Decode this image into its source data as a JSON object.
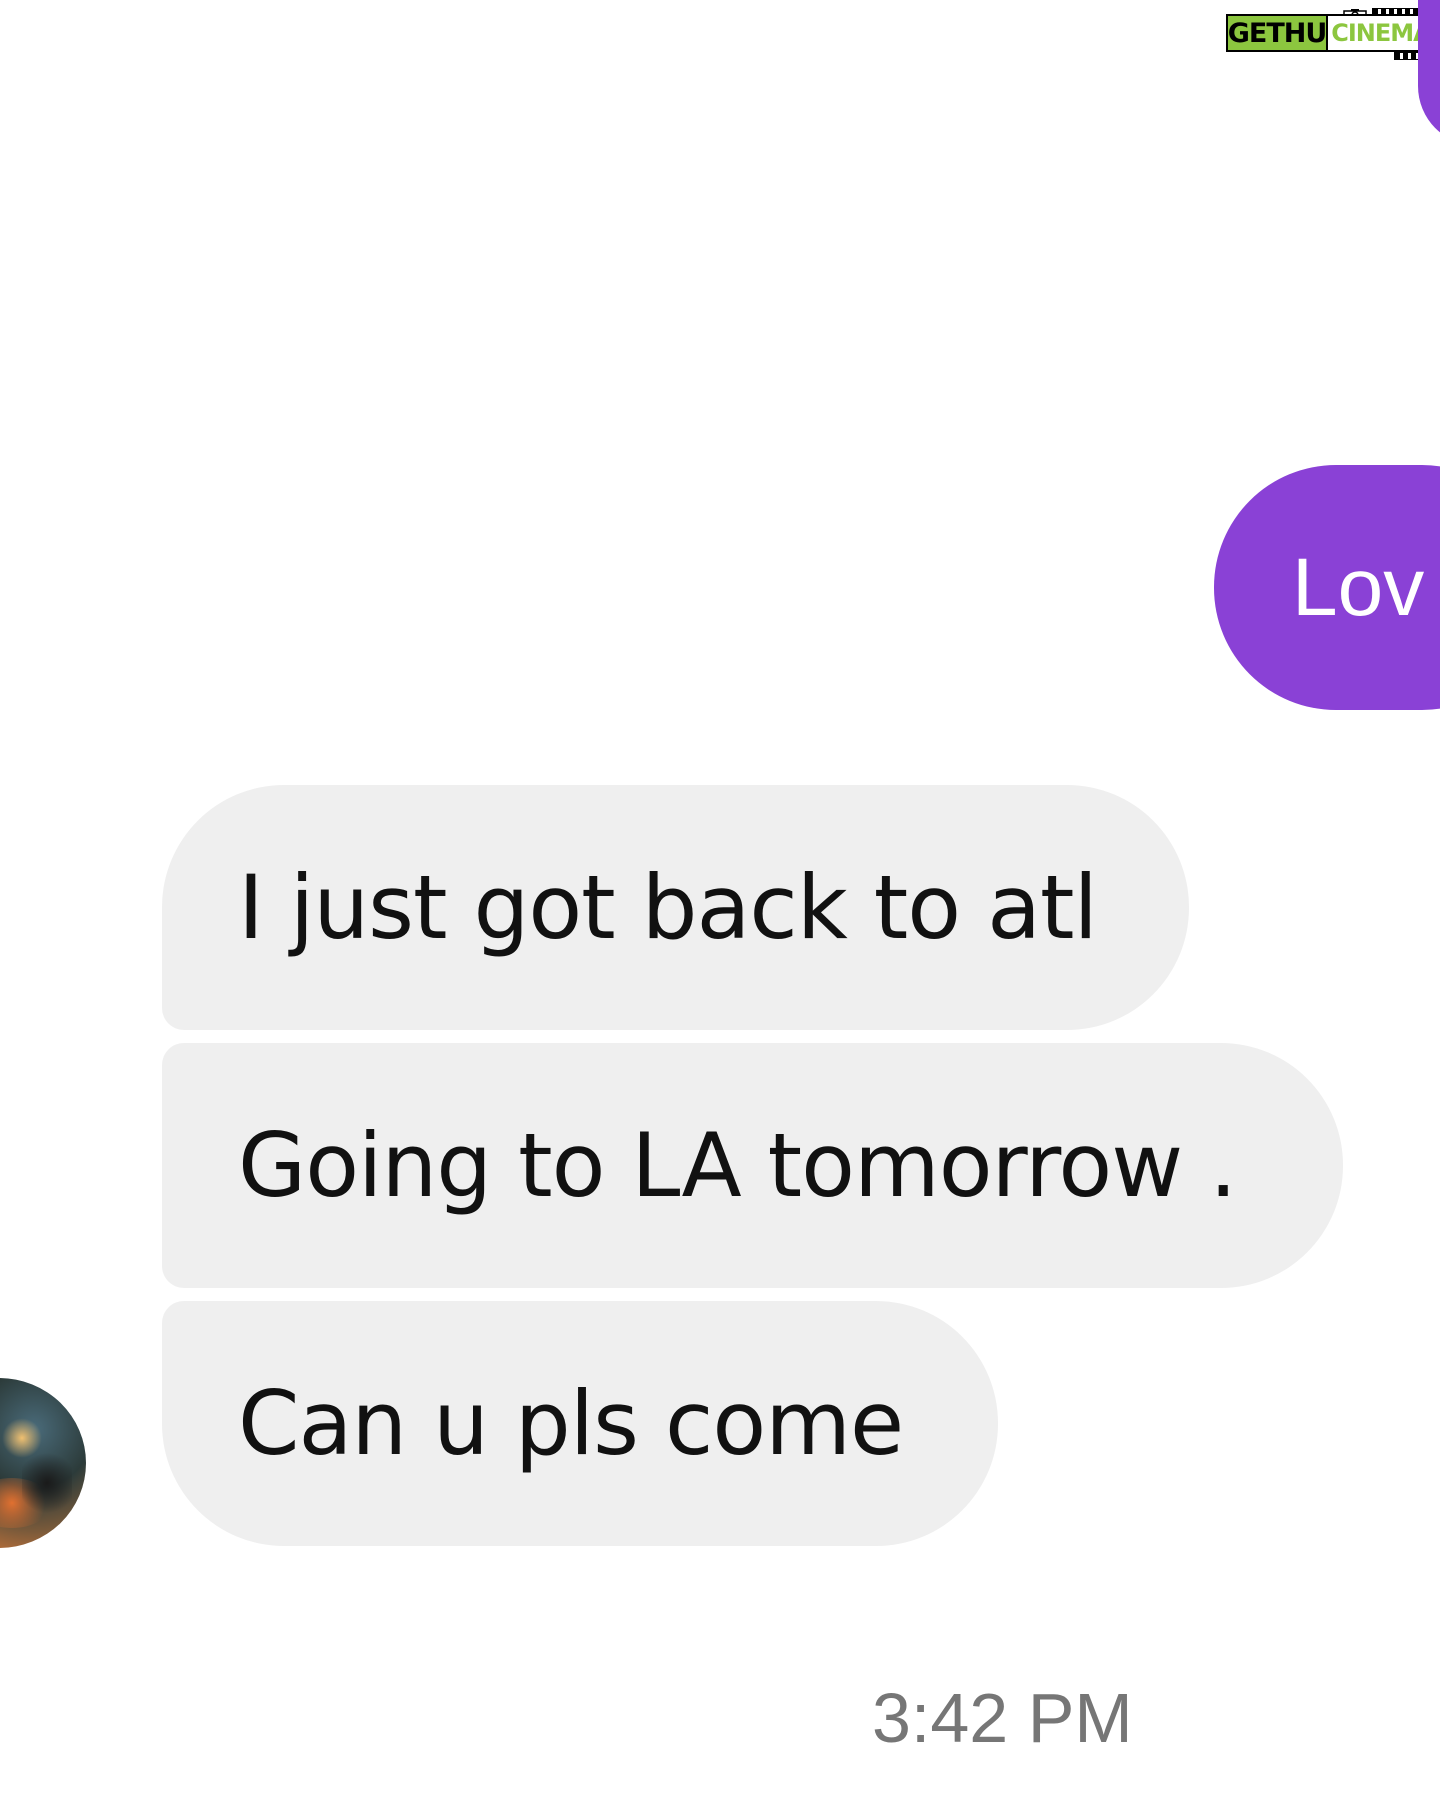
{
  "watermark": {
    "brand_left": "GETHU",
    "brand_right": "CINEMA"
  },
  "colors": {
    "sent_bubble": "#8a41d6",
    "received_bubble": "#efefef",
    "timestamp": "#767676",
    "watermark_green": "#8cc63f"
  },
  "conversation": {
    "sent_messages": [
      {
        "text": ""
      },
      {
        "text": "Lov"
      }
    ],
    "received_messages": [
      {
        "text": "I just got back to atl"
      },
      {
        "text": "Going to LA tomorrow ."
      },
      {
        "text": "Can u pls come"
      }
    ],
    "timestamp": "3:42 PM"
  }
}
